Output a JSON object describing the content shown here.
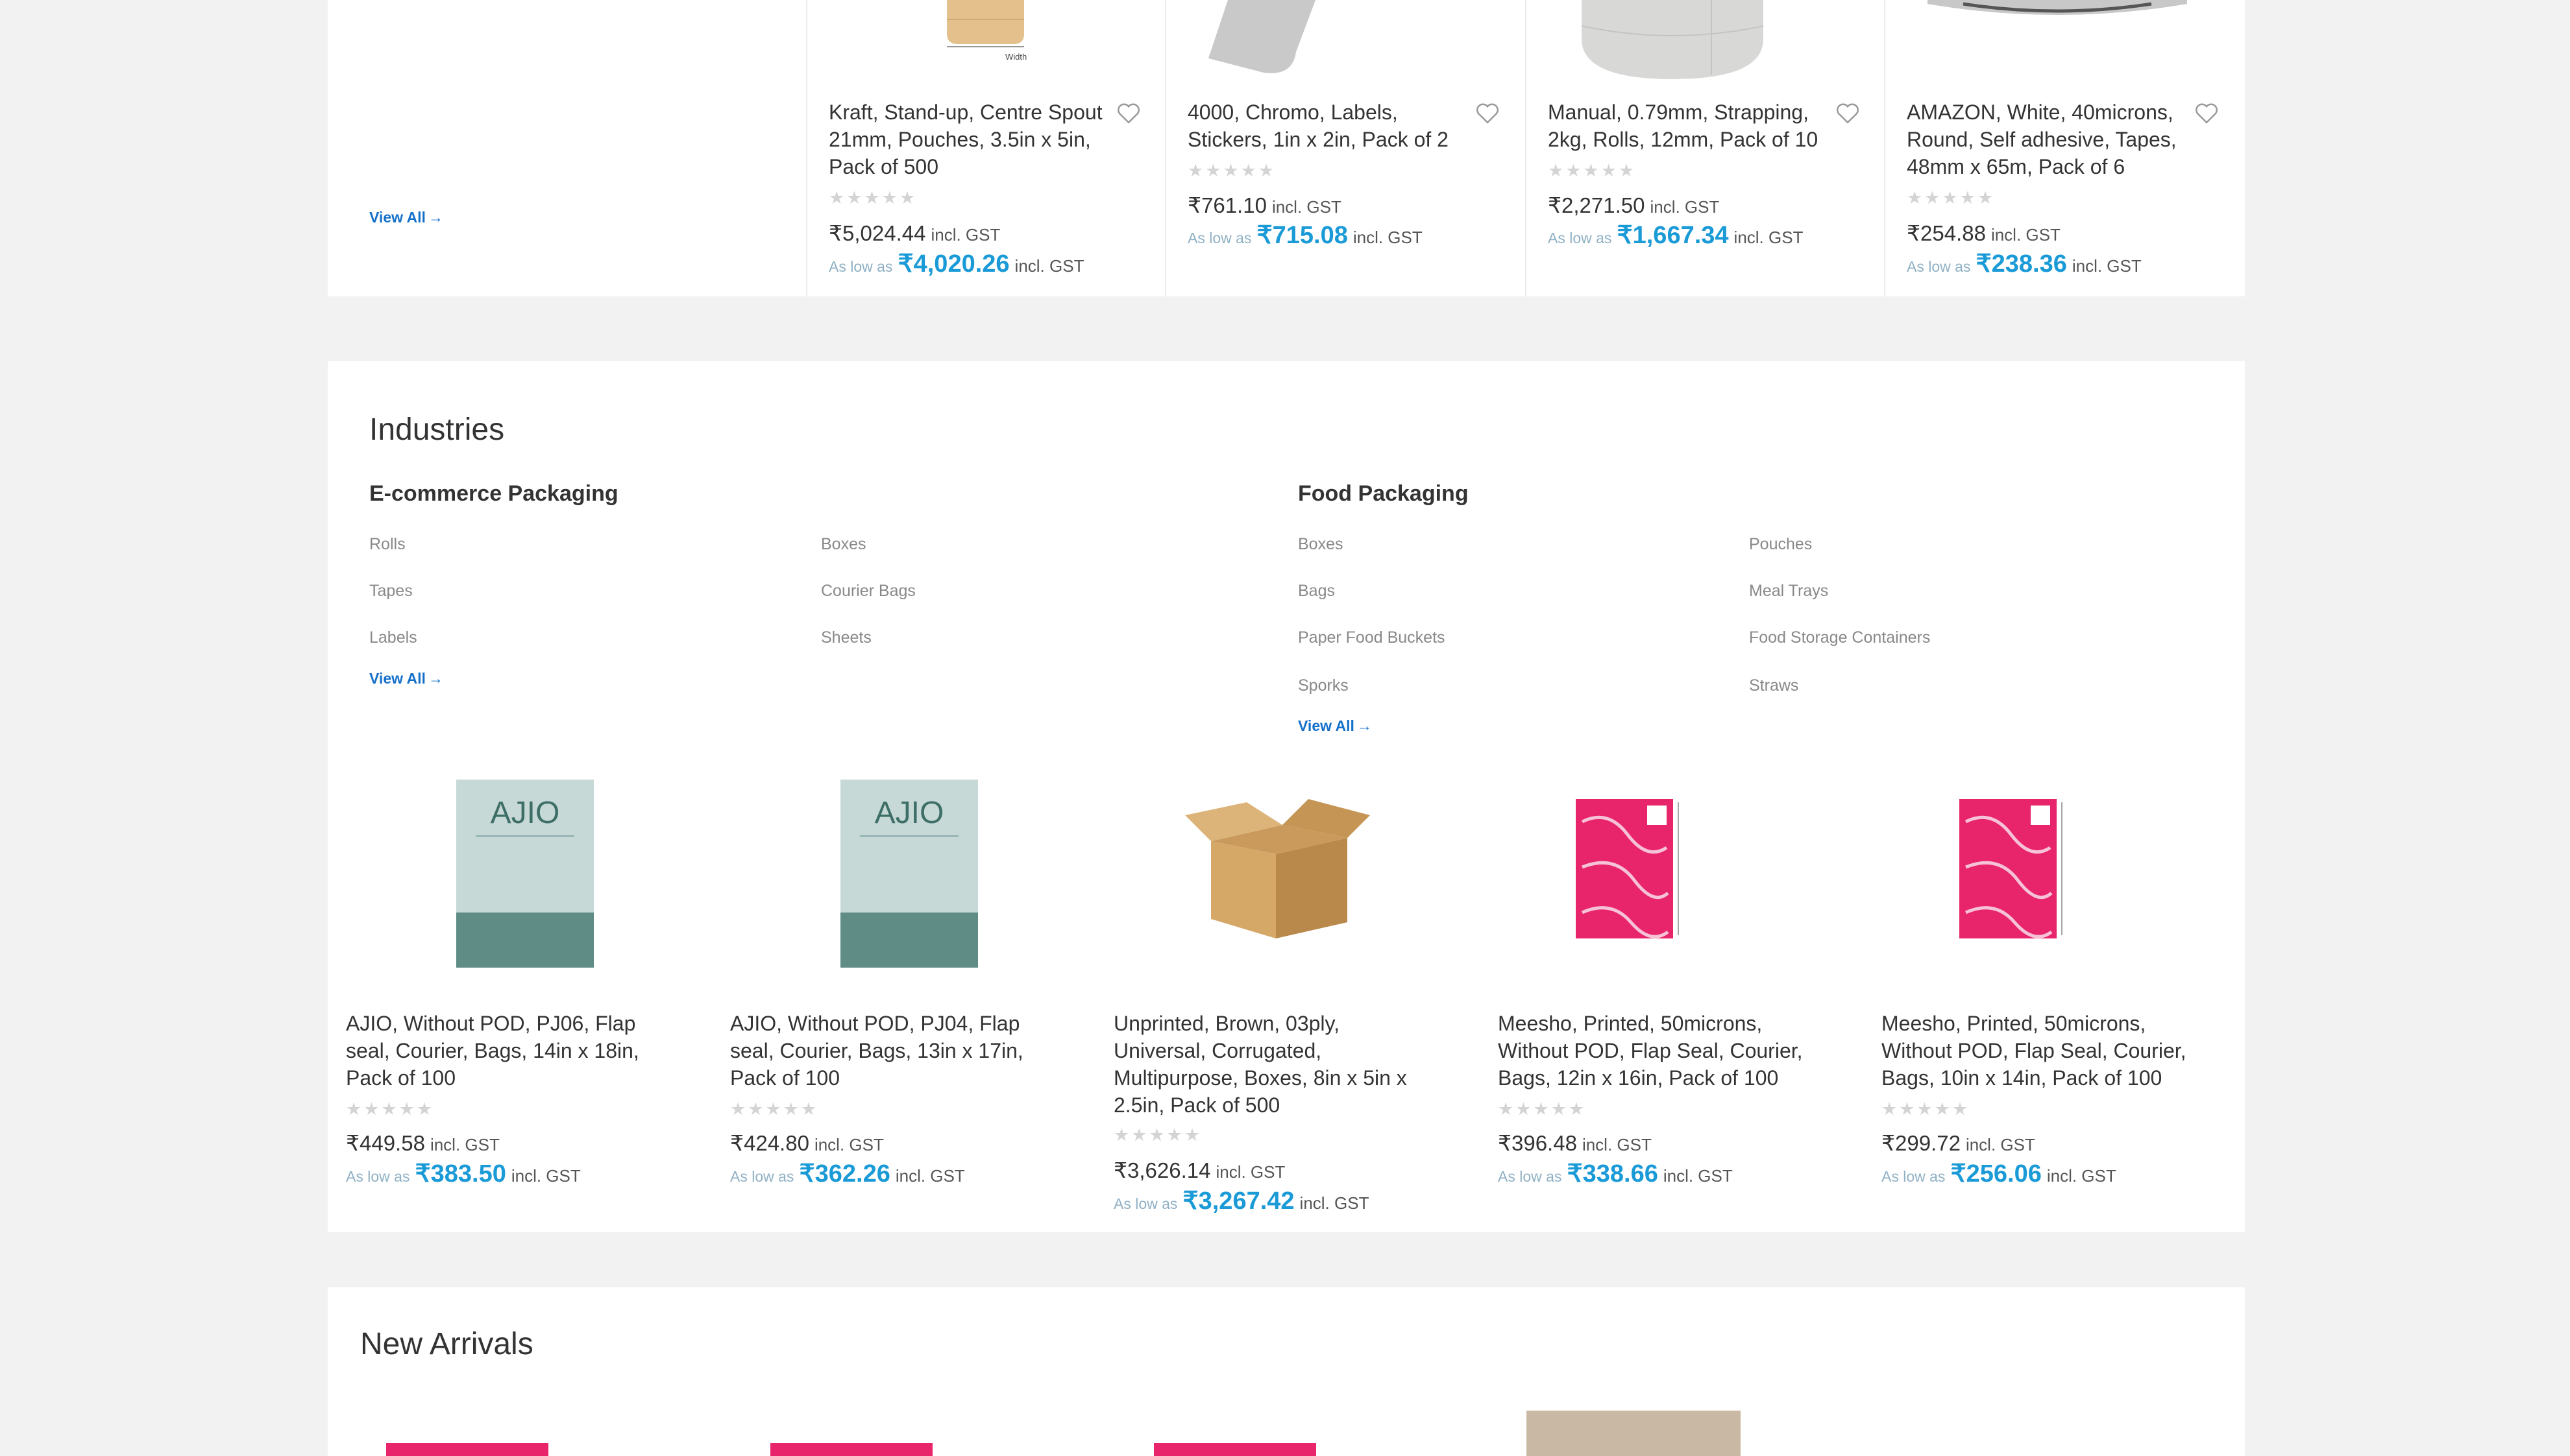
{
  "top_row": {
    "view_all": "View All",
    "products": [
      {
        "title": "Kraft, Stand-up, Centre Spout 21mm, Pouches, 3.5in x 5in, Pack of 500",
        "price": "₹5,024.44",
        "incl": "incl. GST",
        "as_low_as_label": "As low as",
        "as_low_price": "₹4,020.26",
        "as_low_incl": "incl. GST",
        "rating_stars": 0,
        "image_label": "Width",
        "image_icon": "kraft-pouch-image"
      },
      {
        "title": "4000, Chromo, Labels, Stickers, 1in x 2in, Pack of 2",
        "price": "₹761.10",
        "incl": "incl. GST",
        "as_low_as_label": "As low as",
        "as_low_price": "₹715.08",
        "as_low_incl": "incl. GST",
        "rating_stars": 0,
        "image_icon": "label-sheet-image"
      },
      {
        "title": "Manual, 0.79mm, Strapping, 2kg, Rolls, 12mm, Pack of 10",
        "price": "₹2,271.50",
        "incl": "incl. GST",
        "as_low_as_label": "As low as",
        "as_low_price": "₹1,667.34",
        "as_low_incl": "incl. GST",
        "rating_stars": 0,
        "image_icon": "strapping-roll-image"
      },
      {
        "title": "AMAZON, White, 40microns, Round, Self adhesive, Tapes, 48mm x 65m, Pack of 6",
        "price": "₹254.88",
        "incl": "incl. GST",
        "as_low_as_label": "As low as",
        "as_low_price": "₹238.36",
        "as_low_incl": "incl. GST",
        "rating_stars": 0,
        "image_icon": "tape-roll-image"
      }
    ]
  },
  "industries": {
    "title": "Industries",
    "groups": [
      {
        "title": "E-commerce Packaging",
        "col1": [
          "Rolls",
          "Tapes",
          "Labels"
        ],
        "col2": [
          "Boxes",
          "Courier Bags",
          "Sheets"
        ],
        "view_all": "View All"
      },
      {
        "title": "Food Packaging",
        "col1": [
          "Boxes",
          "Bags",
          "Paper Food Buckets",
          "Sporks"
        ],
        "col2": [
          "Pouches",
          "Meal Trays",
          "Food Storage Containers",
          "Straws"
        ],
        "view_all": "View All"
      }
    ],
    "products": [
      {
        "title": "AJIO, Without POD, PJ06, Flap seal, Courier, Bags, 14in x 18in, Pack of 100",
        "price": "₹449.58",
        "incl": "incl. GST",
        "as_low_as_label": "As low as",
        "as_low_price": "₹383.50",
        "as_low_incl": "incl. GST",
        "rating_stars": 0,
        "image_brand": "AJIO",
        "image_icon": "ajio-courier-bag-image"
      },
      {
        "title": "AJIO, Without POD, PJ04, Flap seal, Courier, Bags, 13in x 17in, Pack of 100",
        "price": "₹424.80",
        "incl": "incl. GST",
        "as_low_as_label": "As low as",
        "as_low_price": "₹362.26",
        "as_low_incl": "incl. GST",
        "rating_stars": 0,
        "image_brand": "AJIO",
        "image_icon": "ajio-courier-bag-image"
      },
      {
        "title": "Unprinted, Brown, 03ply, Universal, Corrugated, Multipurpose, Boxes, 8in x 5in x 2.5in, Pack of 500",
        "price": "₹3,626.14",
        "incl": "incl. GST",
        "as_low_as_label": "As low as",
        "as_low_price": "₹3,267.42",
        "as_low_incl": "incl. GST",
        "rating_stars": 0,
        "image_icon": "corrugated-box-image"
      },
      {
        "title": "Meesho, Printed, 50microns, Without POD, Flap Seal, Courier, Bags, 12in x 16in, Pack of 100",
        "price": "₹396.48",
        "incl": "incl. GST",
        "as_low_as_label": "As low as",
        "as_low_price": "₹338.66",
        "as_low_incl": "incl. GST",
        "rating_stars": 0,
        "image_icon": "meesho-courier-bag-image"
      },
      {
        "title": "Meesho, Printed, 50microns, Without POD, Flap Seal, Courier, Bags, 10in x 14in, Pack of 100",
        "price": "₹299.72",
        "incl": "incl. GST",
        "as_low_as_label": "As low as",
        "as_low_price": "₹256.06",
        "as_low_incl": "incl. GST",
        "rating_stars": 0,
        "image_icon": "meesho-courier-bag-image"
      }
    ]
  },
  "new_arrivals": {
    "title": "New Arrivals"
  },
  "colors": {
    "accent_blue": "#1a9ad6",
    "link_blue": "#1570c9",
    "background": "#f2f2f2",
    "meesho_pink": "#e8246b"
  }
}
